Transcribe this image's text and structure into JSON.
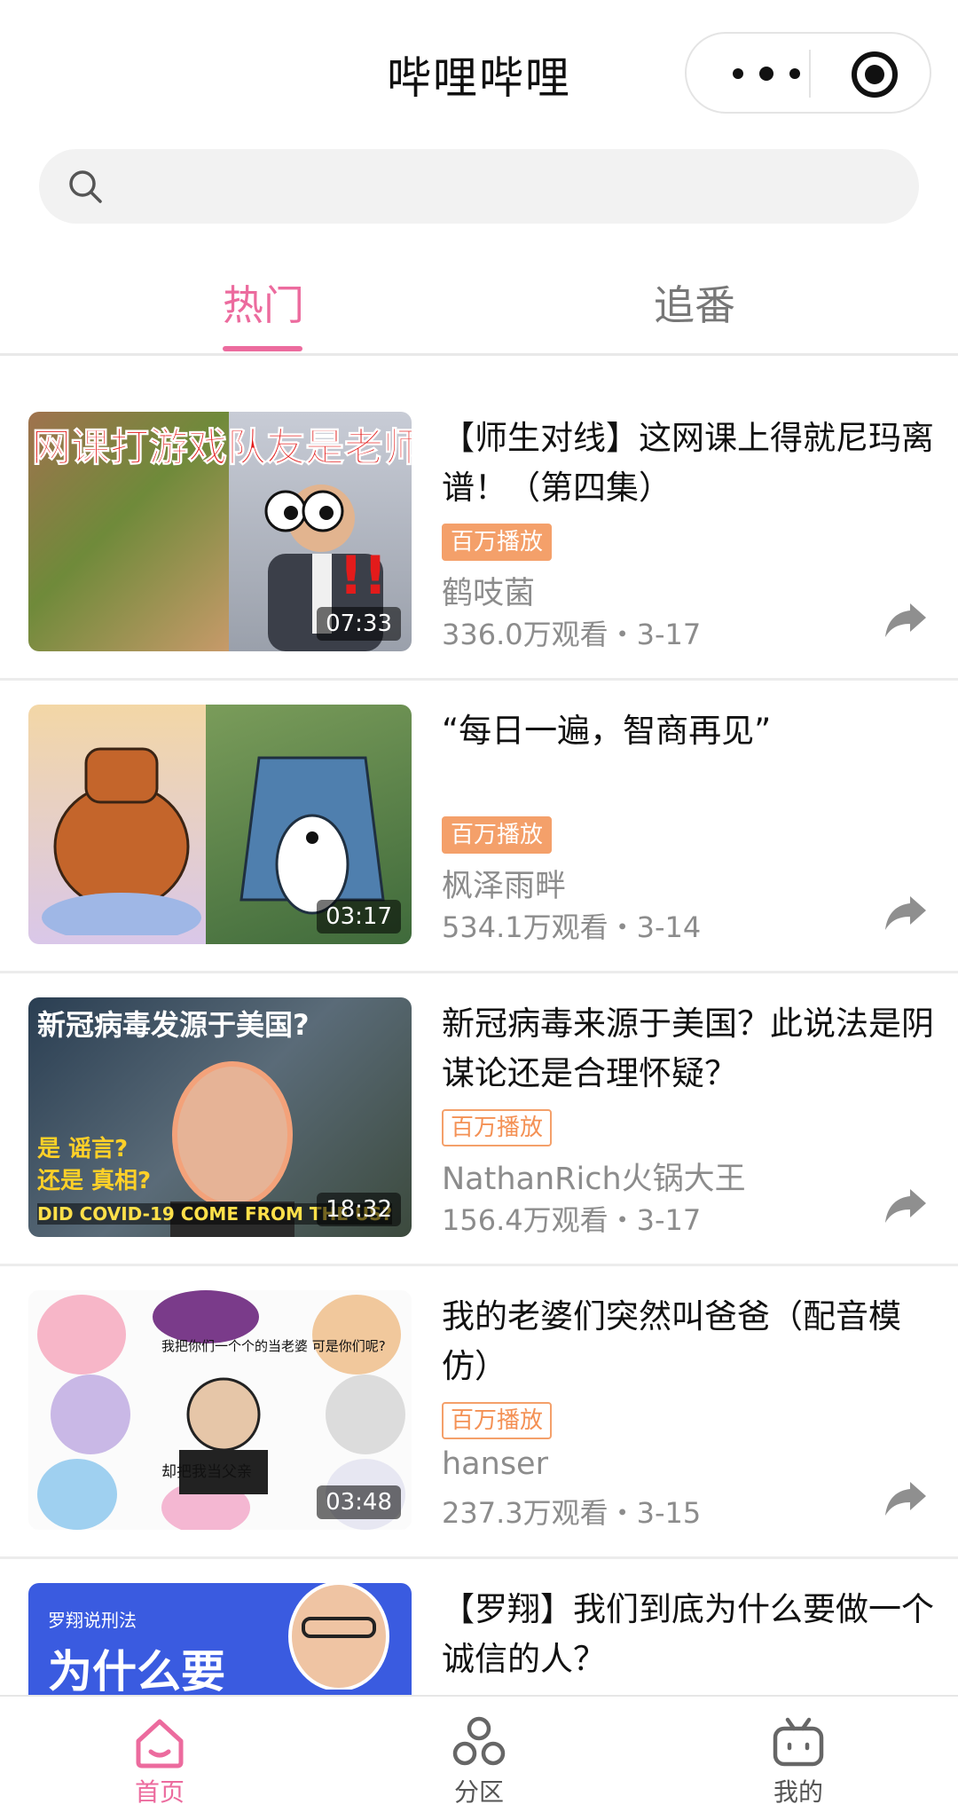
{
  "header": {
    "title": "哔哩哔哩",
    "more_icon": "more-dots-icon",
    "target_icon": "target-circle-icon"
  },
  "search": {
    "placeholder": "",
    "value": ""
  },
  "tabs": [
    {
      "label": "热门",
      "active": true
    },
    {
      "label": "追番",
      "active": false
    }
  ],
  "videos": [
    {
      "title": "【师生对线】这网课上得就尼玛离谱！（第四集）",
      "badge": "百万播放",
      "badge_style": "filled",
      "author": "鹤吱菌",
      "stats": "336.0万观看・3-17",
      "duration": "07:33",
      "thumb_text": "网课打游戏队友是老师"
    },
    {
      "title": "“每日一遍，智商再见”",
      "badge": "百万播放",
      "badge_style": "filled",
      "author": "枫泽雨畔",
      "stats": "534.1万观看・3-14",
      "duration": "03:17"
    },
    {
      "title": "新冠病毒来源于美国？此说法是阴谋论还是合理怀疑？",
      "badge": "百万播放",
      "badge_style": "outline",
      "author": "NathanRich火锅大王",
      "stats": "156.4万观看・3-17",
      "duration": "18:32",
      "thumb_text": "新冠病毒发源于美国?",
      "thumb_text_2": "是 谣言?",
      "thumb_text_3": "还是 真相?",
      "thumb_text_4": "DID COVID-19 COME FROM THE US?"
    },
    {
      "title": "我的老婆们突然叫爸爸（配音模仿）",
      "badge": "百万播放",
      "badge_style": "outline",
      "author": "hanser",
      "stats": "237.3万观看・3-15",
      "duration": "03:48",
      "thumb_text": "我把你们一个个的当老婆 可是你们呢?",
      "thumb_text_2": "却把我当父亲"
    },
    {
      "title": "【罗翔】我们到底为什么要做一个诚信的人？",
      "thumb_text": "罗翔说刑法",
      "thumb_text_2": "为什么要"
    }
  ],
  "nav": [
    {
      "label": "首页",
      "icon": "home-icon",
      "active": true
    },
    {
      "label": "分区",
      "icon": "category-icon",
      "active": false
    },
    {
      "label": "我的",
      "icon": "tv-icon",
      "active": false
    }
  ],
  "colors": {
    "accent": "#ec6b9e",
    "badge": "#f4a06a",
    "muted": "#8c8c8c"
  }
}
